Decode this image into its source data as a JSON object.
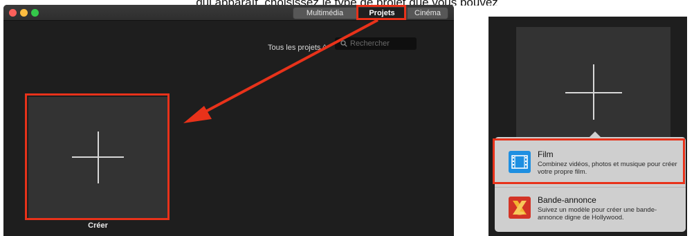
{
  "caption": "qui apparaît, choisissez le type de projet que vous pouvez",
  "left_window": {
    "tabs": [
      {
        "label": "Multimédia"
      },
      {
        "label": "Projets"
      },
      {
        "label": "Cinéma"
      }
    ],
    "filter_label": "Tous les projets ◊",
    "search": {
      "placeholder": "Rechercher"
    },
    "create_label": "Créer"
  },
  "right_panel": {
    "items": [
      {
        "title": "Film",
        "description": "Combinez vidéos, photos et musique pour créer votre propre film.",
        "icon": "film-strip-icon"
      },
      {
        "title": "Bande-annonce",
        "description": "Suivez un modèle pour créer une bande-annonce digne de Hollywood.",
        "icon": "spotlight-trailer-icon"
      }
    ]
  },
  "colors": {
    "highlight": "#e8321a",
    "window_bg": "#1e1e1e",
    "tile_bg": "#333333",
    "film_icon": "#1e8fe1",
    "trailer_icon": "#d33426"
  }
}
